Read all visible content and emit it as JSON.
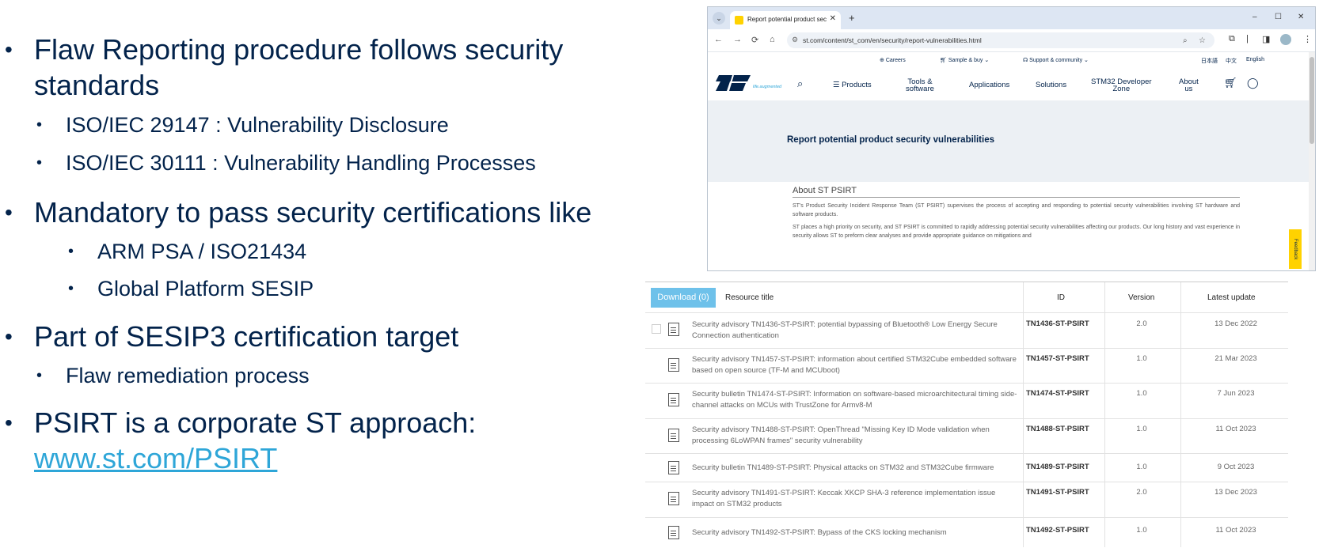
{
  "slide": {
    "bullets": [
      {
        "level": 1,
        "lines": [
          "Flaw Reporting procedure follows security",
          "standards"
        ]
      },
      {
        "level": 2,
        "text": "ISO/IEC 29147 : Vulnerability Disclosure"
      },
      {
        "level": 2,
        "text": "ISO/IEC 30111 : Vulnerability Handling Processes"
      },
      {
        "level": 1,
        "text": "Mandatory to pass security certifications like"
      },
      {
        "level": 3,
        "text": "ARM PSA / ISO21434"
      },
      {
        "level": 3,
        "text": "Global Platform SESIP"
      },
      {
        "level": 1,
        "text": "Part of SESIP3 certification target"
      },
      {
        "level": 2,
        "text": "Flaw remediation process"
      },
      {
        "level": 1,
        "text": "PSIRT is a corporate ST approach:"
      }
    ],
    "bullet_glyph": "•",
    "link": "www.st.com/PSIRT"
  },
  "browser": {
    "tab_title": "Report potential product securi",
    "tab_close": "✕",
    "tab_new": "+",
    "window_controls": [
      "–",
      "☐",
      "✕"
    ],
    "url": "st.com/content/st_com/en/security/report-vulnerabilities.html",
    "nav_icons": [
      "←",
      "→",
      "⟳",
      "⌂"
    ],
    "top_links": [
      "Careers",
      "Sample & buy",
      "Support & community"
    ],
    "languages": [
      "日本語",
      "中文",
      "English"
    ],
    "menu": [
      "Products",
      "Tools &",
      "software",
      "Applications",
      "Solutions",
      "STM32 Developer",
      "Zone",
      "About",
      "us"
    ],
    "logo_tagline": "life.augmented",
    "page_title": "Report potential product security vulnerabilities",
    "about_heading": "About ST PSIRT",
    "about_p1": "ST's Product Security Incident Response Team (ST PSIRT) supervises the process of accepting and responding to potential security vulnerabilities involving ST hardware and software products.",
    "about_p2": "ST places a high priority on security, and ST PSIRT is committed to rapidly addressing potential security vulnerabilities affecting our products. Our long history and vast experience in security allows ST to preform clear analyses and provide appropriate guidance on mitigations and",
    "feedback": "Feedback"
  },
  "resources": {
    "download_label": "Download (0)",
    "headers": {
      "title": "Resource title",
      "id": "ID",
      "version": "Version",
      "updated": "Latest update"
    },
    "rows": [
      {
        "title": "Security advisory TN1436-ST-PSIRT: potential bypassing of Bluetooth® Low Energy Secure Connection authentication",
        "id": "TN1436-ST-PSIRT",
        "version": "2.0",
        "date": "13 Dec 2022"
      },
      {
        "title": "Security advisory TN1457-ST-PSIRT: information about certified STM32Cube embedded software based on open source (TF-M and MCUboot)",
        "id": "TN1457-ST-PSIRT",
        "version": "1.0",
        "date": "21 Mar 2023"
      },
      {
        "title": "Security bulletin TN1474-ST-PSIRT: Information on software-based microarchitectural timing side-channel attacks on MCUs with TrustZone for Armv8-M",
        "id": "TN1474-ST-PSIRT",
        "version": "1.0",
        "date": "7 Jun 2023"
      },
      {
        "title": "Security advisory TN1488-ST-PSIRT: OpenThread \"Missing Key ID Mode validation when processing 6LoWPAN frames\" security vulnerability",
        "id": "TN1488-ST-PSIRT",
        "version": "1.0",
        "date": "11 Oct 2023"
      },
      {
        "title": "Security bulletin TN1489-ST-PSIRT: Physical attacks on STM32 and STM32Cube firmware",
        "id": "TN1489-ST-PSIRT",
        "version": "1.0",
        "date": "9 Oct 2023"
      },
      {
        "title": "Security advisory TN1491-ST-PSIRT: Keccak XKCP SHA-3 reference implementation issue impact on STM32 products",
        "id": "TN1491-ST-PSIRT",
        "version": "2.0",
        "date": "13 Dec 2023"
      },
      {
        "title": "Security advisory TN1492-ST-PSIRT: Bypass of the CKS locking mechanism",
        "id": "TN1492-ST-PSIRT",
        "version": "1.0",
        "date": "11 Oct 2023"
      }
    ]
  }
}
